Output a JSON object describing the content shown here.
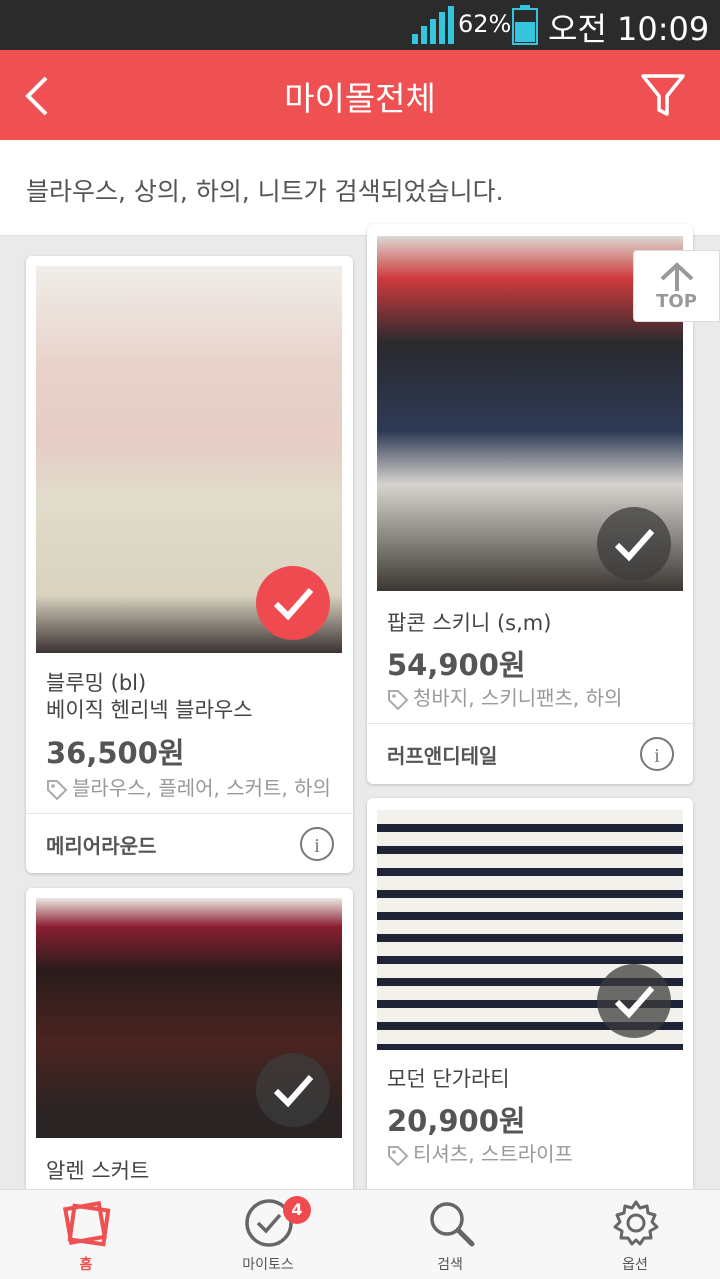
{
  "status_bar": {
    "battery": "62%",
    "time": "오전 10:09"
  },
  "header": {
    "title": "마이몰전체"
  },
  "search_result": "블라우스, 상의, 하의, 니트가 검색되었습니다.",
  "top_button": "TOP",
  "products": [
    {
      "name_line1": "블루밍 (bl)",
      "name_line2": "베이직 헨리넥 블라우스",
      "price": "36,500원",
      "tags": "블라우스, 플레어, 스커트, 하의",
      "shop": "메리어라운드",
      "checked": true
    },
    {
      "name_line1": "팝콘 스키니 (s,m)",
      "price": "54,900원",
      "tags": "청바지, 스키니팬츠, 하의",
      "shop": "러프앤디테일",
      "checked": false
    },
    {
      "name_line1": "알렌 스커트",
      "checked": false
    },
    {
      "name_line1": "모던 단가라티",
      "price": "20,900원",
      "tags": "티셔츠, 스트라이프",
      "checked": false
    }
  ],
  "bottom_nav": [
    {
      "label": "홈",
      "icon": "home-icon",
      "active": true
    },
    {
      "label": "마이토스",
      "icon": "check-circle-icon",
      "badge": "4"
    },
    {
      "label": "검색",
      "icon": "search-icon"
    },
    {
      "label": "옵션",
      "icon": "gear-icon"
    }
  ],
  "colors": {
    "accent": "#ef5052",
    "status_bar": "#2b2b2b"
  }
}
